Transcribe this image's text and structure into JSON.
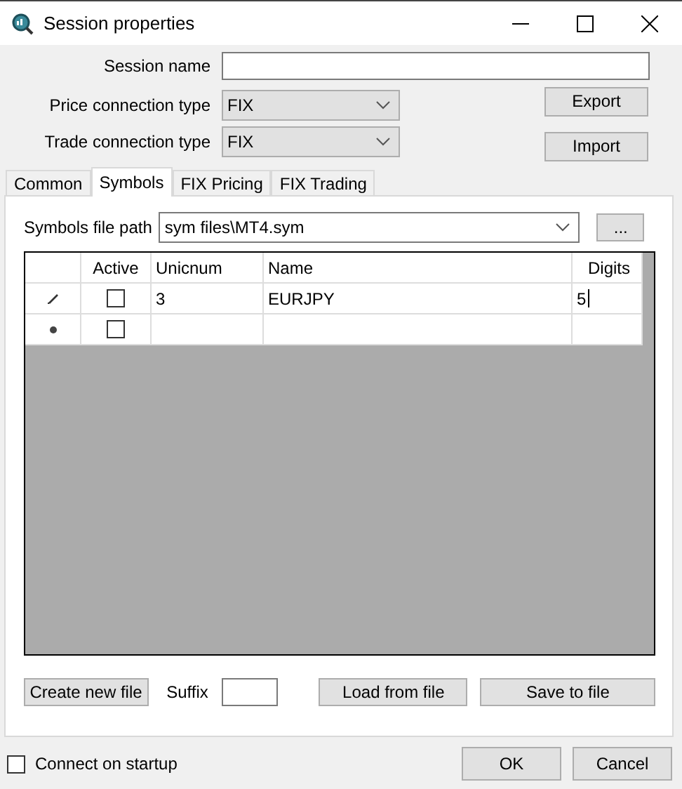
{
  "window": {
    "title": "Session properties"
  },
  "session_name": {
    "label": "Session name"
  },
  "connections": [
    {
      "label": "Price connection type",
      "value": "FIX",
      "button": "Export"
    },
    {
      "label": "Trade connection type",
      "value": "FIX",
      "button": "Import"
    }
  ],
  "tabs": [
    {
      "label": "Common",
      "selected": false
    },
    {
      "label": "Symbols",
      "selected": true
    },
    {
      "label": "FIX Pricing",
      "selected": false
    },
    {
      "label": "FIX Trading",
      "selected": false
    }
  ],
  "symbols_file_path": {
    "label": "Symbols file path",
    "value": "sym files\\MT4.sym",
    "browse": "..."
  },
  "table": {
    "columns": [
      "Active",
      "Unicnum",
      "Name",
      "Digits"
    ],
    "rows": [
      {
        "kind": "editing",
        "active": false,
        "unicnum": "3",
        "name": "EURJPY",
        "digits": "5"
      },
      {
        "kind": "new",
        "active": false
      }
    ]
  },
  "file_actions": {
    "create": "Create new file",
    "suffix_label": "Suffix",
    "load": "Load from file",
    "save": "Save to file"
  },
  "connect_on_startup": {
    "label": "Connect on startup",
    "checked": false
  },
  "buttons": [
    "OK",
    "Cancel"
  ]
}
